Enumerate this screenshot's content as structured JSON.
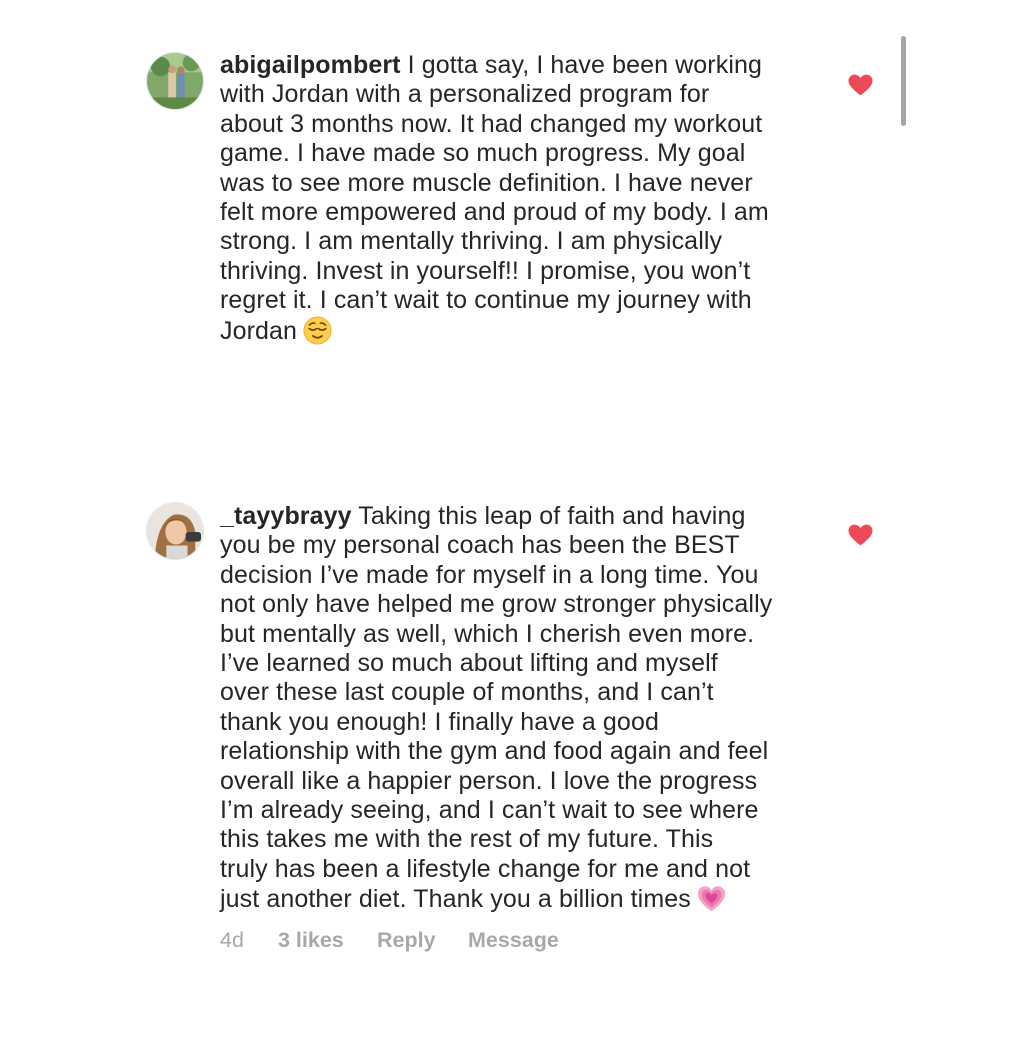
{
  "comments": [
    {
      "username": "abigailpombert",
      "lines": [
        "I gotta say, I have been working",
        "with Jordan with a personalized program for",
        "about 3 months now. It had changed my workout",
        "game. I have made so much progress. My goal",
        "was to see more muscle definition. I have never",
        "felt more empowered and proud of my body. I am",
        "strong. I am mentally thriving. I am physically",
        "thriving. Invest in yourself!! I promise, you won’t",
        "regret it. I can’t wait to continue my journey with",
        "Jordan"
      ],
      "emoji": "relieved-face-emoji",
      "liked": true,
      "heart_color": "#ed4956"
    },
    {
      "username": "_tayybrayy",
      "lines": [
        "Taking this leap of faith and having",
        "you be my personal coach has been the BEST",
        "decision I’ve made for myself in a long time. You",
        "not only have helped me grow stronger physically",
        "but mentally as well, which I cherish even more.",
        "I’ve learned so much about lifting and myself",
        "over these last couple of months, and I can’t",
        "thank you enough! I finally have a good",
        "relationship with the gym and food again and feel",
        "overall like a happier person. I love the progress",
        "I’m already seeing, and I can’t wait to see where",
        "this takes me with the rest of my future. This",
        "truly has been a lifestyle change for me and not",
        "just another diet. Thank you a billion times"
      ],
      "emoji": "growing-heart-emoji",
      "liked": true,
      "heart_color": "#ed4956",
      "meta": {
        "time": "4d",
        "likes": "3 likes",
        "reply": "Reply",
        "message": "Message"
      }
    }
  ]
}
